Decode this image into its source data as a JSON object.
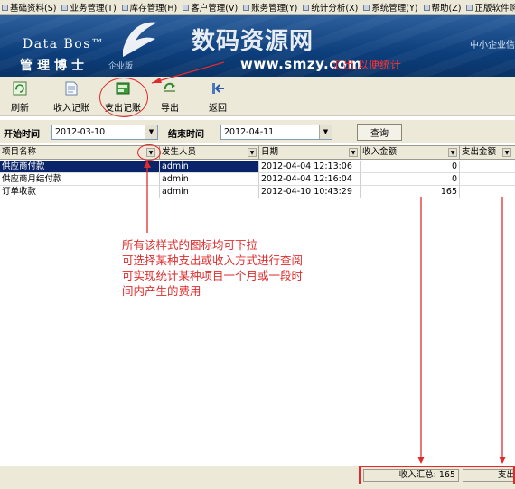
{
  "menu": {
    "items": [
      {
        "label": "基础资料(S)"
      },
      {
        "label": "业务管理(T)"
      },
      {
        "label": "库存管理(H)"
      },
      {
        "label": "客户管理(V)"
      },
      {
        "label": "账务管理(Y)"
      },
      {
        "label": "统计分析(X)"
      },
      {
        "label": "系统管理(Y)"
      },
      {
        "label": "帮助(Z)"
      },
      {
        "label": "正版软件购买"
      }
    ]
  },
  "banner": {
    "brand_en": "Data Bos™",
    "brand_cn": "管理博士",
    "brand_cn_extra": "企业版",
    "right_text": "中小企业信",
    "watermark_title": "数码资源网",
    "watermark_url": "www.smzy.com",
    "annotation": "汇出,以便统计"
  },
  "toolbar": {
    "buttons": [
      {
        "label": "刷新",
        "icon": "refresh-icon"
      },
      {
        "label": "收入记账",
        "icon": "income-record-icon"
      },
      {
        "label": "支出记账",
        "icon": "expense-record-icon"
      },
      {
        "label": "导出",
        "icon": "export-icon"
      },
      {
        "label": "返回",
        "icon": "back-icon"
      }
    ]
  },
  "filter": {
    "start_label": "开始时间",
    "start_value": "2012-03-10",
    "end_label": "结束时间",
    "end_value": "2012-04-11",
    "query_label": "查询"
  },
  "grid": {
    "columns": [
      "项目名称",
      "发生人员",
      "日期",
      "收入金额",
      "支出金额"
    ],
    "rows": [
      {
        "item": "供应商付款",
        "person": "admin",
        "date": "2012-04-04 12:13:06",
        "income": "0",
        "selected": true
      },
      {
        "item": "供应商月结付款",
        "person": "admin",
        "date": "2012-04-04 12:16:04",
        "income": "0",
        "selected": false
      },
      {
        "item": "订单收款",
        "person": "admin",
        "date": "2012-04-10 10:43:29",
        "income": "165",
        "selected": false
      }
    ]
  },
  "annotation": {
    "lines": [
      "所有该样式的图标均可下拉",
      "可选择某种支出或收入方式进行查阅",
      "可实现统计某种项目一个月或一段时",
      "间内产生的费用"
    ]
  },
  "summary": {
    "income_text": "收入汇总: 165",
    "expense_text": "支出"
  },
  "colors": {
    "annotation_red": "#e12b2b",
    "selection_blue": "#0a246a",
    "banner_blue": "#0d3f7d"
  }
}
